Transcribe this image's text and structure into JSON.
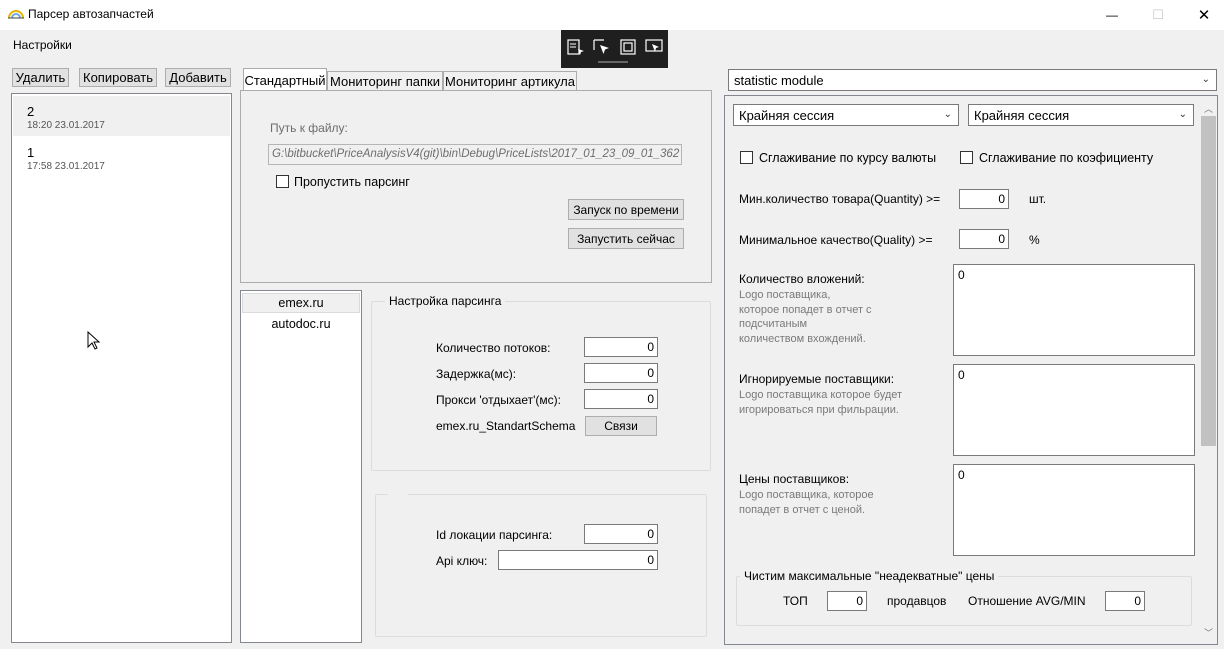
{
  "window": {
    "title": "Парсер автозапчастей",
    "controls": {
      "minimize": "—",
      "maximize": "☐",
      "close": "✕"
    }
  },
  "menu": {
    "settings": "Настройки"
  },
  "toolbar": {
    "delete": "Удалить",
    "copy": "Копировать",
    "add": "Добавить"
  },
  "sessions": [
    {
      "name": "2",
      "time": "18:20 23.01.2017"
    },
    {
      "name": "1",
      "time": "17:58 23.01.2017"
    }
  ],
  "tabs": [
    {
      "label": "Стандартный"
    },
    {
      "label": "Мониторинг папки"
    },
    {
      "label": "Мониторинг артикула"
    }
  ],
  "standard_tab": {
    "path_label": "Путь к файлу:",
    "path_value": "G:\\bitbucket\\PriceAnalysisV4(git)\\bin\\Debug\\PriceLists\\2017_01_23_09_01_362",
    "skip_parsing_label": "Пропустить парсинг",
    "run_by_time": "Запуск по времени",
    "run_now": "Запустить сейчас"
  },
  "sites": [
    "emex.ru",
    "autodoc.ru"
  ],
  "parsing_settings": {
    "title": "Настройка парсинга",
    "threads_label": "Количество потоков:",
    "threads_value": "0",
    "delay_label": "Задержка(мс):",
    "delay_value": "0",
    "proxy_label": "Прокси 'отдыхает'(мс):",
    "proxy_value": "0",
    "schema_label": "emex.ru_StandartSchema",
    "links_button": "Связи"
  },
  "location_settings": {
    "location_label": "Id локации парсинга:",
    "location_value": "0",
    "api_label": "Api ключ:",
    "api_value": "0"
  },
  "statistics": {
    "module_select": "statistic module",
    "session_left": "Крайняя сессия",
    "session_right": "Крайняя сессия",
    "currency_smoothing": "Сглаживание по курсу валюты",
    "coef_smoothing": "Сглаживание по коэфициенту",
    "min_qty_label": "Мин.количество товара(Quantity) >=",
    "min_qty_value": "0",
    "min_qty_unit": "шт.",
    "min_quality_label": "Минимальное качество(Quality) >=",
    "min_quality_value": "0",
    "min_quality_unit": "%",
    "attachments_label": "Количество вложений:",
    "attachments_hint": [
      "Logo поставщика,",
      "которое попадет в отчет с",
      "подсчитаным",
      "количеством вхождений."
    ],
    "attachments_value": "0",
    "ignored_label": "Игнорируемые поставщики:",
    "ignored_hint": [
      "Logo поставщика которое будет",
      "игорироваться при фильрации."
    ],
    "ignored_value": "0",
    "prices_label": "Цены поставщиков:",
    "prices_hint": [
      "Logo поставщика, которое",
      "попадет в отчет с ценой."
    ],
    "prices_value": "0",
    "outliers_title": "Чистим максимальные \"неадекватные\" цены",
    "top_label": "ТОП",
    "top_value": "0",
    "sellers_label": "продавцов",
    "ratio_label": "Отношение AVG/MIN",
    "ratio_value": "0"
  }
}
